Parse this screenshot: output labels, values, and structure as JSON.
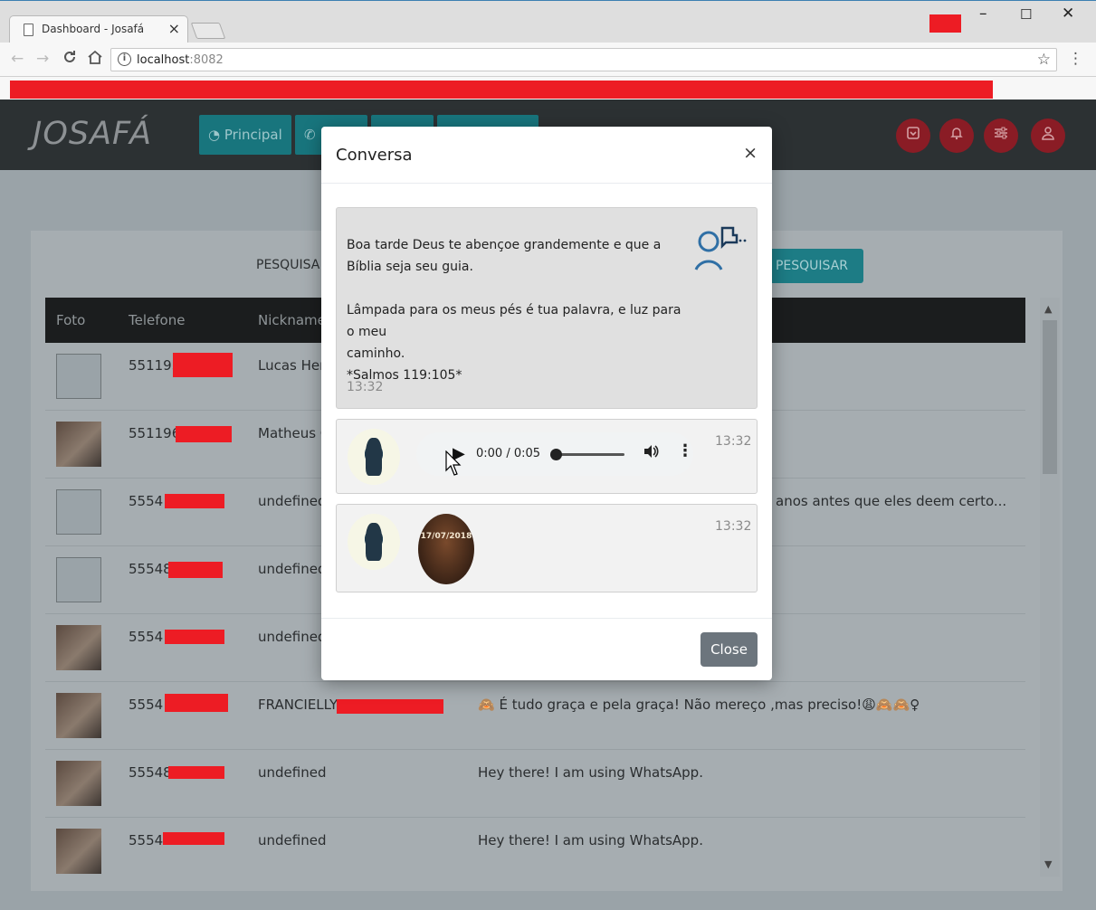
{
  "browser": {
    "tab_title": "Dashboard - Josafá",
    "tab_close": "×",
    "minimize": "–",
    "maximize": "☐",
    "close": "✕",
    "back": "←",
    "forward": "→",
    "reload": "C",
    "home": "⌂",
    "info": "i",
    "url_host": "localhost",
    "url_port": ":8082",
    "star": "☆",
    "menu": "⋮"
  },
  "app": {
    "logo": "JOSAFÁ",
    "nav": [
      {
        "label": "Principal",
        "icon": "dashboard-icon"
      },
      {
        "label": "",
        "icon": "whatsapp-icon"
      },
      {
        "label": ""
      },
      {
        "label": ""
      }
    ],
    "round_icons": [
      "archive-icon",
      "bell-icon",
      "sliders-icon",
      "user-icon"
    ],
    "search_label": "PESQUISA",
    "search_button": "PESQUISAR",
    "table": {
      "headers": [
        "Foto",
        "Telefone",
        "Nickname"
      ],
      "rows": [
        {
          "phone": "551195",
          "nick": "Lucas Hen",
          "status": "",
          "photo": false
        },
        {
          "phone": "551196",
          "nick": "Matheus C",
          "status": "",
          "photo": true
        },
        {
          "phone": "5554",
          "nick": "undefined",
          "status": "anos antes que eles deem certo...",
          "photo": false
        },
        {
          "phone": "55548",
          "nick": "undefined",
          "status": "",
          "photo": false
        },
        {
          "phone": "5554",
          "nick": "undefined",
          "status": "",
          "photo": true
        },
        {
          "phone": "5554",
          "nick": "FRANCIELLY",
          "status": "🙈 É tudo graça e pela graça! Não mereço ,mas preciso!😩🙈🙈♀",
          "photo": true
        },
        {
          "phone": "55548",
          "nick": "undefined",
          "status": "Hey there! I am using WhatsApp.",
          "photo": true
        },
        {
          "phone": "5554",
          "nick": "undefined",
          "status": "Hey there! I am using WhatsApp.",
          "photo": true
        }
      ]
    }
  },
  "modal": {
    "title": "Conversa",
    "close_x": "×",
    "messages": [
      {
        "line1": "Boa tarde Deus te abençoe grandemente e que a",
        "line2": "Bíblia seja seu guia.",
        "line3": "Lâmpada para os meus pés é tua palavra, e luz para o meu",
        "line4": "caminho.",
        "line5": "*Salmos 119:105*",
        "time": "13:32"
      },
      {
        "audio_time": "0:00 / 0:05",
        "time": "13:32"
      },
      {
        "sticker_text": "17/07/2018",
        "time": "13:32"
      }
    ],
    "close_button": "Close"
  }
}
